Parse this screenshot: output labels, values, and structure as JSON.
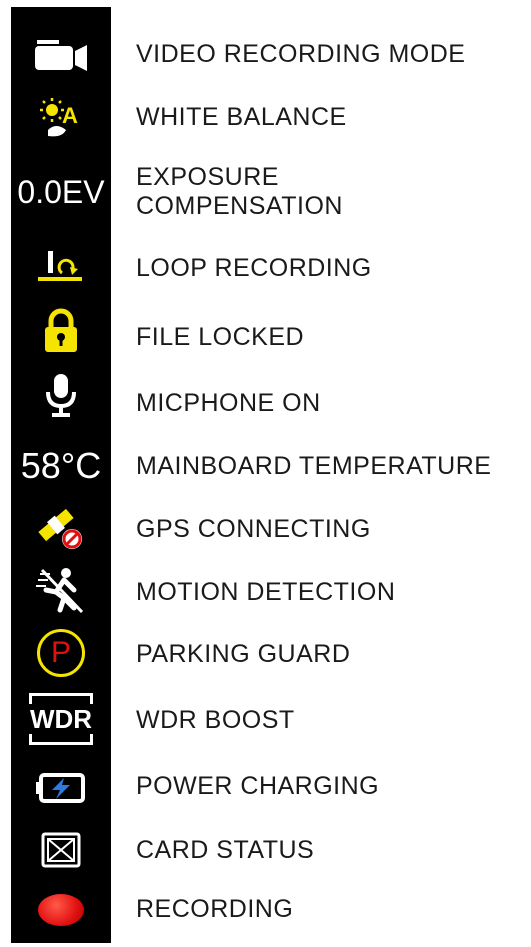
{
  "colors": {
    "strip": "#000000",
    "yellow": "#f5e400",
    "red": "#e11010",
    "blue": "#2d7be0",
    "white": "#ffffff"
  },
  "items": [
    {
      "icon": "video-camera-icon",
      "label": "VIDEO RECORDING MODE"
    },
    {
      "icon": "white-balance-auto-icon",
      "label": "WHITE BALANCE"
    },
    {
      "icon_text": "0.0EV",
      "label_line1": "EXPOSURE",
      "label_line2": "COMPENSATION"
    },
    {
      "icon": "loop-recording-icon",
      "label": "LOOP RECORDING"
    },
    {
      "icon": "padlock-icon",
      "label": "FILE LOCKED"
    },
    {
      "icon": "microphone-icon",
      "label": "MICPHONE ON"
    },
    {
      "icon_text": "58°C",
      "label": "MAINBOARD TEMPERATURE"
    },
    {
      "icon": "gps-satellite-icon",
      "label": "GPS CONNECTING"
    },
    {
      "icon": "motion-detection-icon",
      "label": "MOTION DETECTION"
    },
    {
      "icon": "parking-guard-icon",
      "icon_text": "P",
      "label": "PARKING GUARD"
    },
    {
      "icon": "wdr-icon",
      "icon_text": "WDR",
      "label": "WDR BOOST"
    },
    {
      "icon": "battery-charging-icon",
      "label": "POWER CHARGING"
    },
    {
      "icon": "sd-card-icon",
      "label": "CARD STATUS"
    },
    {
      "icon": "record-dot-icon",
      "label": "RECORDING"
    }
  ]
}
